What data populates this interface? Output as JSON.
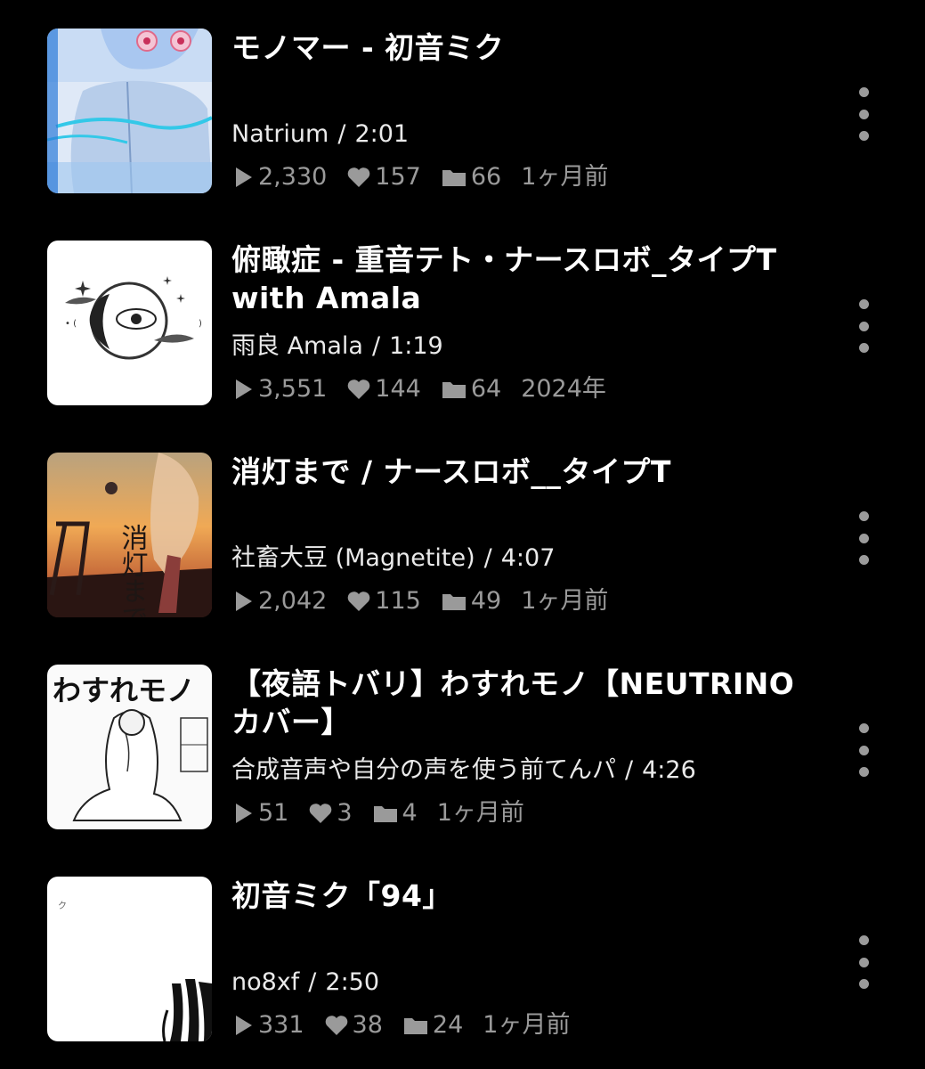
{
  "items": [
    {
      "title_lines": [
        "モノマー - 初音ミク",
        ""
      ],
      "artist": "Natrium",
      "duration": "2:01",
      "plays": "2,330",
      "likes": "157",
      "mylists": "66",
      "age": "1ヶ月前",
      "thumb_text": ""
    },
    {
      "title_lines": [
        "俯瞰症 - 重音テト・ナースロボ_タイプT",
        "with Amala"
      ],
      "artist": "雨良 Amala",
      "duration": "1:19",
      "plays": "3,551",
      "likes": "144",
      "mylists": "64",
      "age": "2024年",
      "thumb_text": ""
    },
    {
      "title_lines": [
        "消灯まで / ナースロボ__タイプT",
        ""
      ],
      "artist": "社畜大豆 (Magnetite)",
      "duration": "4:07",
      "plays": "2,042",
      "likes": "115",
      "mylists": "49",
      "age": "1ヶ月前",
      "thumb_text": "消灯まで"
    },
    {
      "title_lines": [
        "【夜語トバリ】わすれモノ【NEUTRINO",
        "カバー】"
      ],
      "artist": "合成音声や自分の声を使う前てんパ",
      "duration": "4:26",
      "plays": "51",
      "likes": "3",
      "mylists": "4",
      "age": "1ヶ月前",
      "thumb_text": "わすれモノ"
    },
    {
      "title_lines": [
        "初音ミク「94」",
        ""
      ],
      "artist": "no8xf",
      "duration": "2:50",
      "plays": "331",
      "likes": "38",
      "mylists": "24",
      "age": "1ヶ月前",
      "thumb_text": ""
    }
  ],
  "meta_separator": "/",
  "icons": {
    "play": "play-icon",
    "like": "heart-icon",
    "mylist": "folder-icon",
    "more": "more-vertical-icon"
  },
  "colors": {
    "background": "#000000",
    "title": "#ffffff",
    "meta": "#eaeaea",
    "stats": "#9a9a9a",
    "more_dots": "#9b9b9b"
  }
}
